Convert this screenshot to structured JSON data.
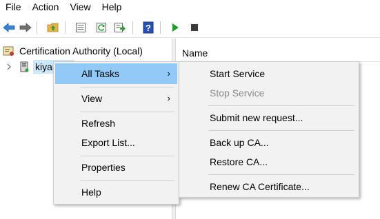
{
  "menubar": {
    "items": [
      "File",
      "Action",
      "View",
      "Help"
    ]
  },
  "toolbar": {
    "buttons": [
      "back-arrow-icon",
      "forward-arrow-icon",
      "folder-up-icon",
      "properties-icon",
      "refresh-icon",
      "export-list-icon",
      "help-icon",
      "start-service-icon",
      "stop-service-icon"
    ]
  },
  "tree": {
    "root_label": "Certification Authority (Local)",
    "child_label": "kiyan"
  },
  "list": {
    "column_name": "Name"
  },
  "context_menu": {
    "items": [
      {
        "label": "All Tasks",
        "submenu": true
      },
      {
        "label": "View",
        "submenu": true
      },
      {
        "label": "Refresh"
      },
      {
        "label": "Export List..."
      },
      {
        "label": "Properties"
      },
      {
        "label": "Help"
      }
    ]
  },
  "all_tasks_menu": {
    "items": [
      {
        "label": "Start Service"
      },
      {
        "label": "Stop Service",
        "disabled": true
      },
      {
        "label": "Submit new request..."
      },
      {
        "label": "Back up CA..."
      },
      {
        "label": "Restore CA..."
      },
      {
        "label": "Renew CA Certificate..."
      }
    ]
  },
  "colors": {
    "highlight": "#91c9f7",
    "selection": "#cce8ff",
    "menu_bg": "#f2f2f2",
    "accent_green": "#1a9e2a",
    "accent_blue": "#2a6bd1"
  }
}
